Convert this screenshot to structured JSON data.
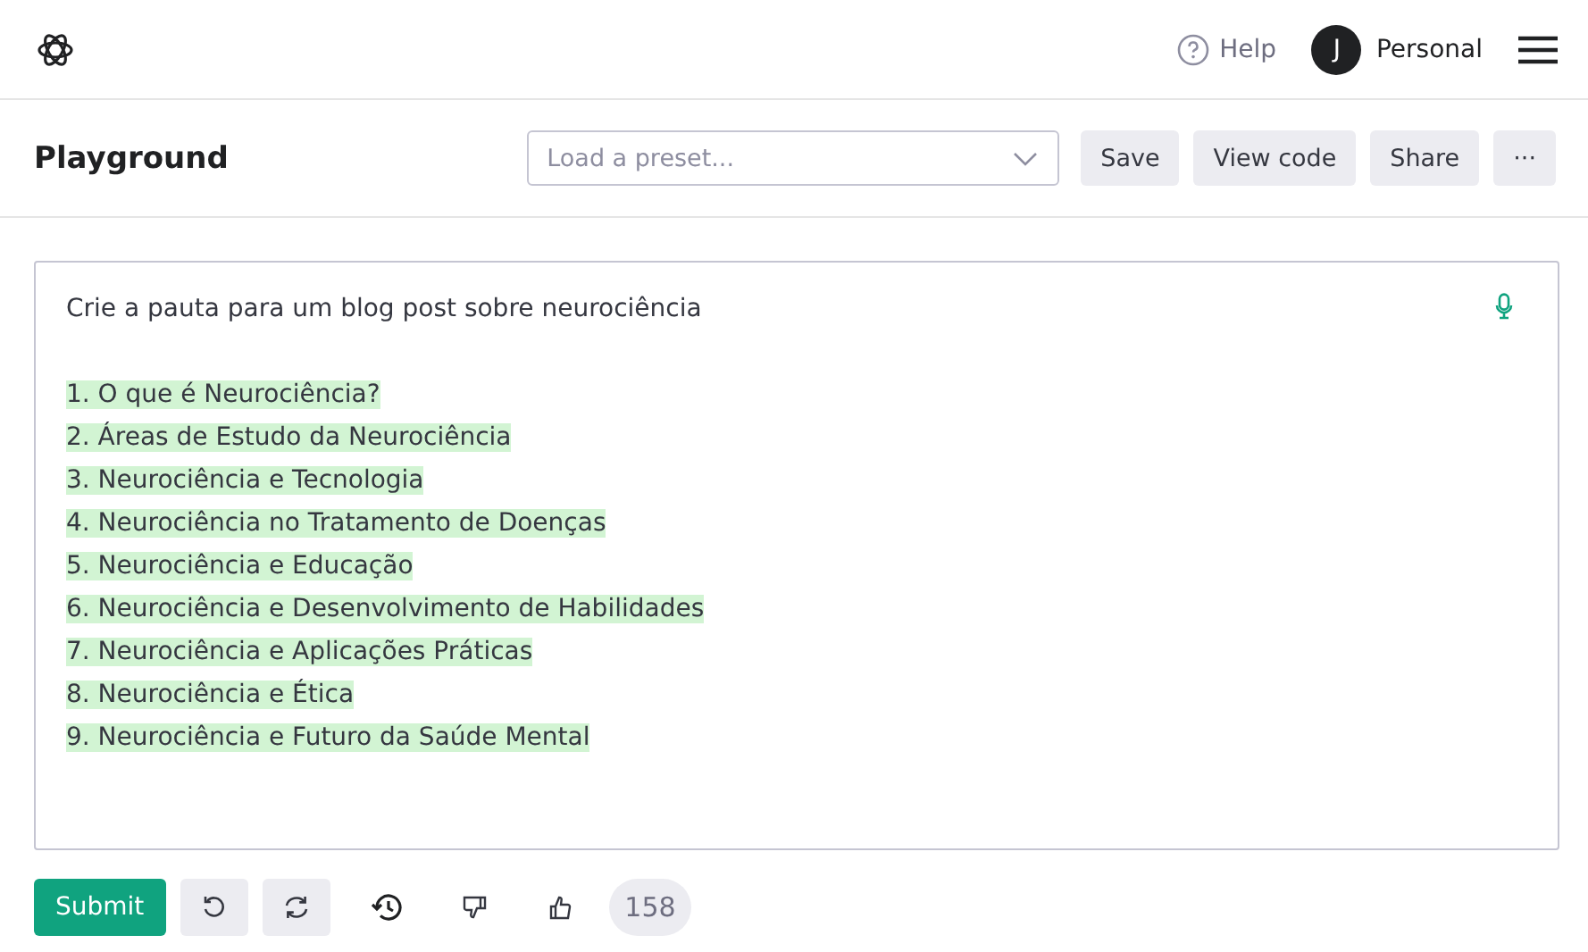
{
  "header": {
    "help": "Help",
    "avatar_initial": "J",
    "account": "Personal"
  },
  "toolbar": {
    "title": "Playground",
    "preset": {
      "placeholder": "Load a preset..."
    },
    "buttons": [
      "Save",
      "View code",
      "Share",
      "···"
    ]
  },
  "editor": {
    "prompt": "Crie a pauta para um blog post sobre neurociência",
    "completion": [
      {
        "text": "1. O que é Neurociência?",
        "highlighted": true
      },
      {
        "text": "2. Áreas de Estudo da Neurociência",
        "highlighted": true
      },
      {
        "text": "3. Neurociência e Tecnologia",
        "highlighted": true
      },
      {
        "text": "4. Neurociência no Tratamento de Doenças",
        "highlighted": true
      },
      {
        "text": "5. Neurociência e Educação",
        "highlighted": true
      },
      {
        "text": "6. Neurociência e Desenvolvimento de Habilidades",
        "highlighted": true
      },
      {
        "text": "7. Neurociência e Aplicações Práticas",
        "highlighted": true
      },
      {
        "text": "8. Neurociência e Ética",
        "highlighted": true
      },
      {
        "text": "9. Neurociência e Futuro da Saúde Mental",
        "highlighted": true
      }
    ]
  },
  "footer": {
    "submit": "Submit",
    "token_count": "158"
  }
}
